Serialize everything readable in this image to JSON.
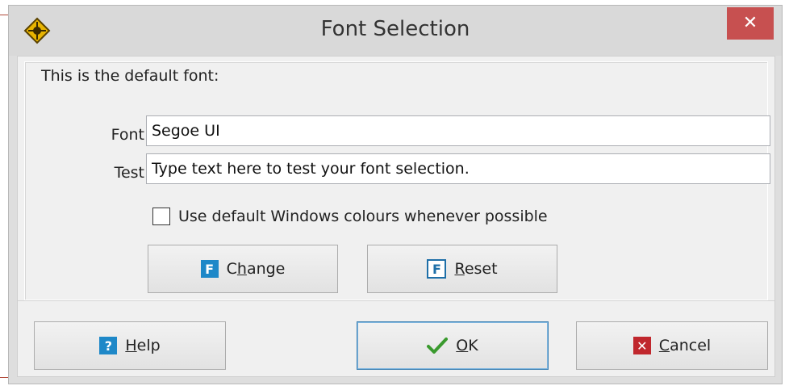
{
  "window": {
    "title": "Font Selection",
    "close_glyph": "✕"
  },
  "group": {
    "caption": "This is the default font:"
  },
  "fields": {
    "font_label": "Font",
    "font_value": "Segoe UI",
    "test_label": "Test",
    "test_value": "Type text here to test your font selection."
  },
  "checkbox": {
    "label": "Use default Windows colours whenever possible",
    "checked": false
  },
  "buttons": {
    "change": {
      "pre": "C",
      "ul": "h",
      "post": "ange",
      "icon": "font-icon"
    },
    "reset": {
      "pre": "",
      "ul": "R",
      "post": "eset",
      "icon": "font-reset-icon"
    },
    "help": {
      "pre": "",
      "ul": "H",
      "post": "elp",
      "icon": "help-icon"
    },
    "ok": {
      "pre": "",
      "ul": "O",
      "post": "K",
      "icon": "checkmark-icon"
    },
    "cancel": {
      "pre": "",
      "ul": "C",
      "post": "ancel",
      "icon": "cancel-icon"
    }
  },
  "colors": {
    "close_red": "#c75050",
    "icon_blue": "#1e88c8",
    "ok_green": "#3a9a2e",
    "cancel_red": "#c0272d"
  }
}
